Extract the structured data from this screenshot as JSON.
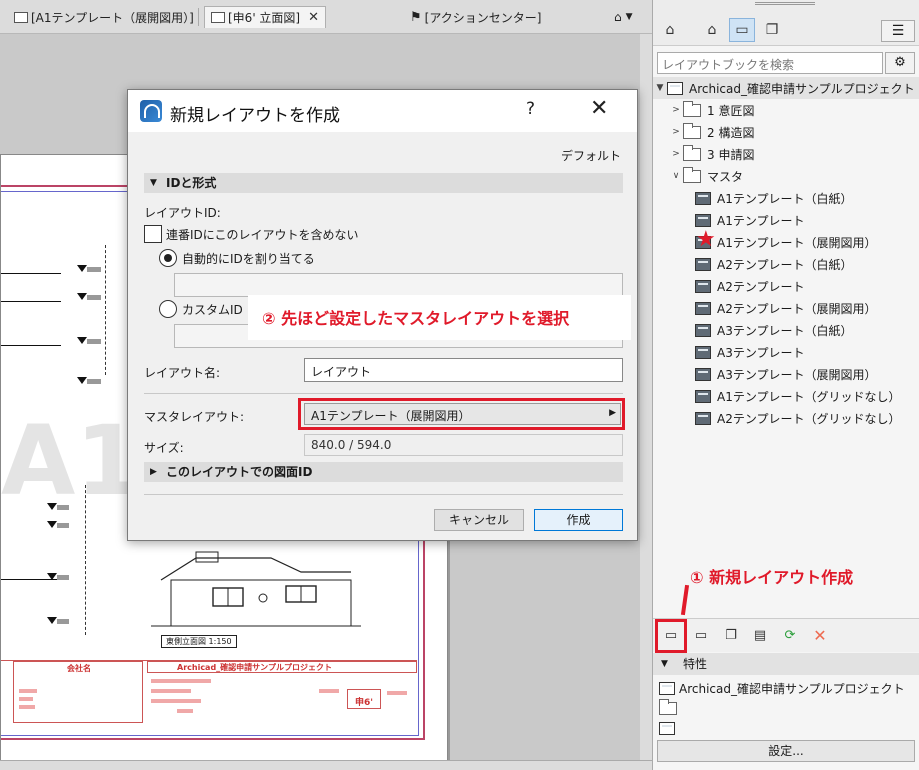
{
  "tabs": [
    {
      "label": "[A1テンプレート（展開図用）]",
      "active": false
    },
    {
      "label": "[申6' 立面図]",
      "active": true
    },
    {
      "label": "[アクションセンター]",
      "active": false
    }
  ],
  "drawing": {
    "big_text": "A1",
    "caption": "東側立面図 1:150",
    "company": "会社名",
    "project": "Archicad_確認申請サンプルプロジェクト",
    "sheet_no": "申6'"
  },
  "dialog": {
    "title": "新規レイアウトを作成",
    "help": "?",
    "close": "✕",
    "default_label": "デフォルト",
    "section_id": "IDと形式",
    "layout_id_label": "レイアウトID:",
    "exclude_label": "連番IDにこのレイアウトを含めない",
    "auto_label": "自動的にIDを割り当てる",
    "custom_label": "カスタムID",
    "name_label": "レイアウト名:",
    "name_value": "レイアウト",
    "master_label": "マスタレイアウト:",
    "master_value": "A1テンプレート（展開図用）",
    "size_label": "サイズ:",
    "size_value": "840.0 / 594.0",
    "section_drawing": "このレイアウトでの図面ID",
    "cancel": "キャンセル",
    "create": "作成"
  },
  "callouts": {
    "step2": "② 先ほど設定したマスタレイアウトを選択",
    "step1": "① 新規レイアウト作成"
  },
  "panel": {
    "search_placeholder": "レイアウトブックを検索",
    "root": "Archicad_確認申請サンプルプロジェクト",
    "folders": [
      "1 意匠図",
      "2 構造図",
      "3 申請図"
    ],
    "master_folder": "マスタ",
    "masters": [
      "A1テンプレート（白紙）",
      "A1テンプレート",
      "A1テンプレート（展開図用）",
      "A2テンプレート（白紙）",
      "A2テンプレート",
      "A2テンプレート（展開図用）",
      "A3テンプレート（白紙）",
      "A3テンプレート",
      "A3テンプレート（展開図用）",
      "A1テンプレート（グリッドなし）",
      "A2テンプレート（グリッドなし）"
    ],
    "properties": "特性",
    "prop_project": "Archicad_確認申請サンプルプロジェクト",
    "settings": "設定..."
  }
}
